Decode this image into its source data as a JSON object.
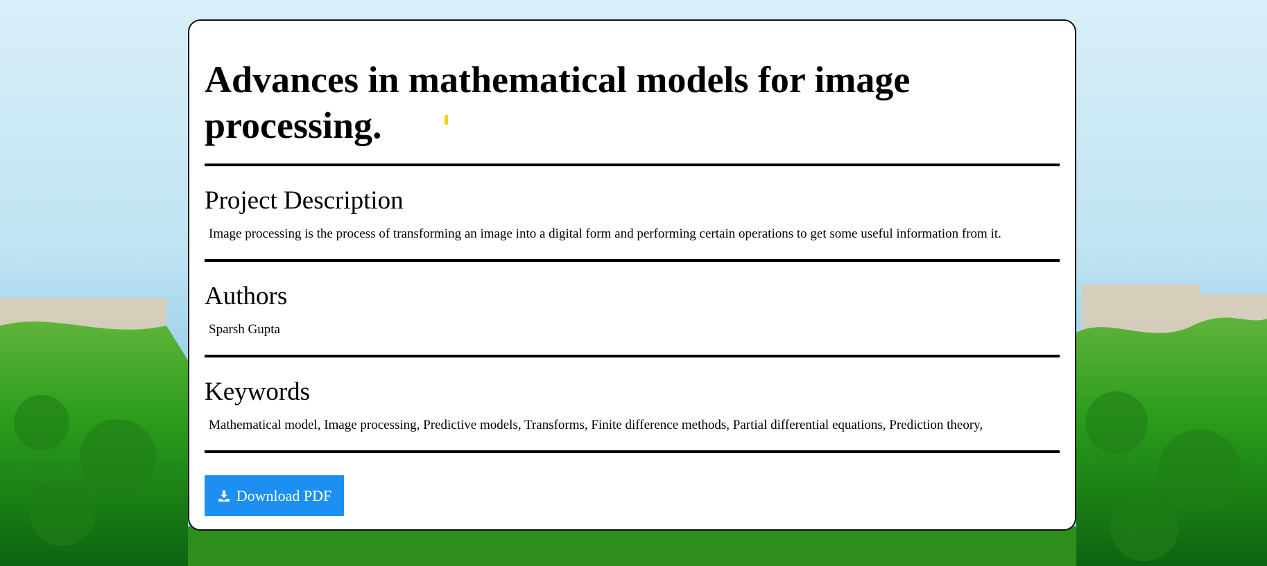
{
  "page": {
    "title": "Advances in mathematical models for image processing."
  },
  "sections": {
    "description": {
      "heading": "Project Description",
      "text": "Image processing is the process of transforming an image into a digital form and performing certain operations to get some useful information from it."
    },
    "authors": {
      "heading": "Authors",
      "text": "Sparsh Gupta"
    },
    "keywords": {
      "heading": "Keywords",
      "text": "Mathematical model, Image processing, Predictive models, Transforms, Finite difference methods, Partial differential equations, Prediction theory,"
    }
  },
  "actions": {
    "download_label": "Download PDF",
    "download_icon": "download-icon"
  },
  "colors": {
    "button": "#1e8ff2",
    "card_bg": "#ffffff",
    "accent_mark": "#f4d21f"
  }
}
